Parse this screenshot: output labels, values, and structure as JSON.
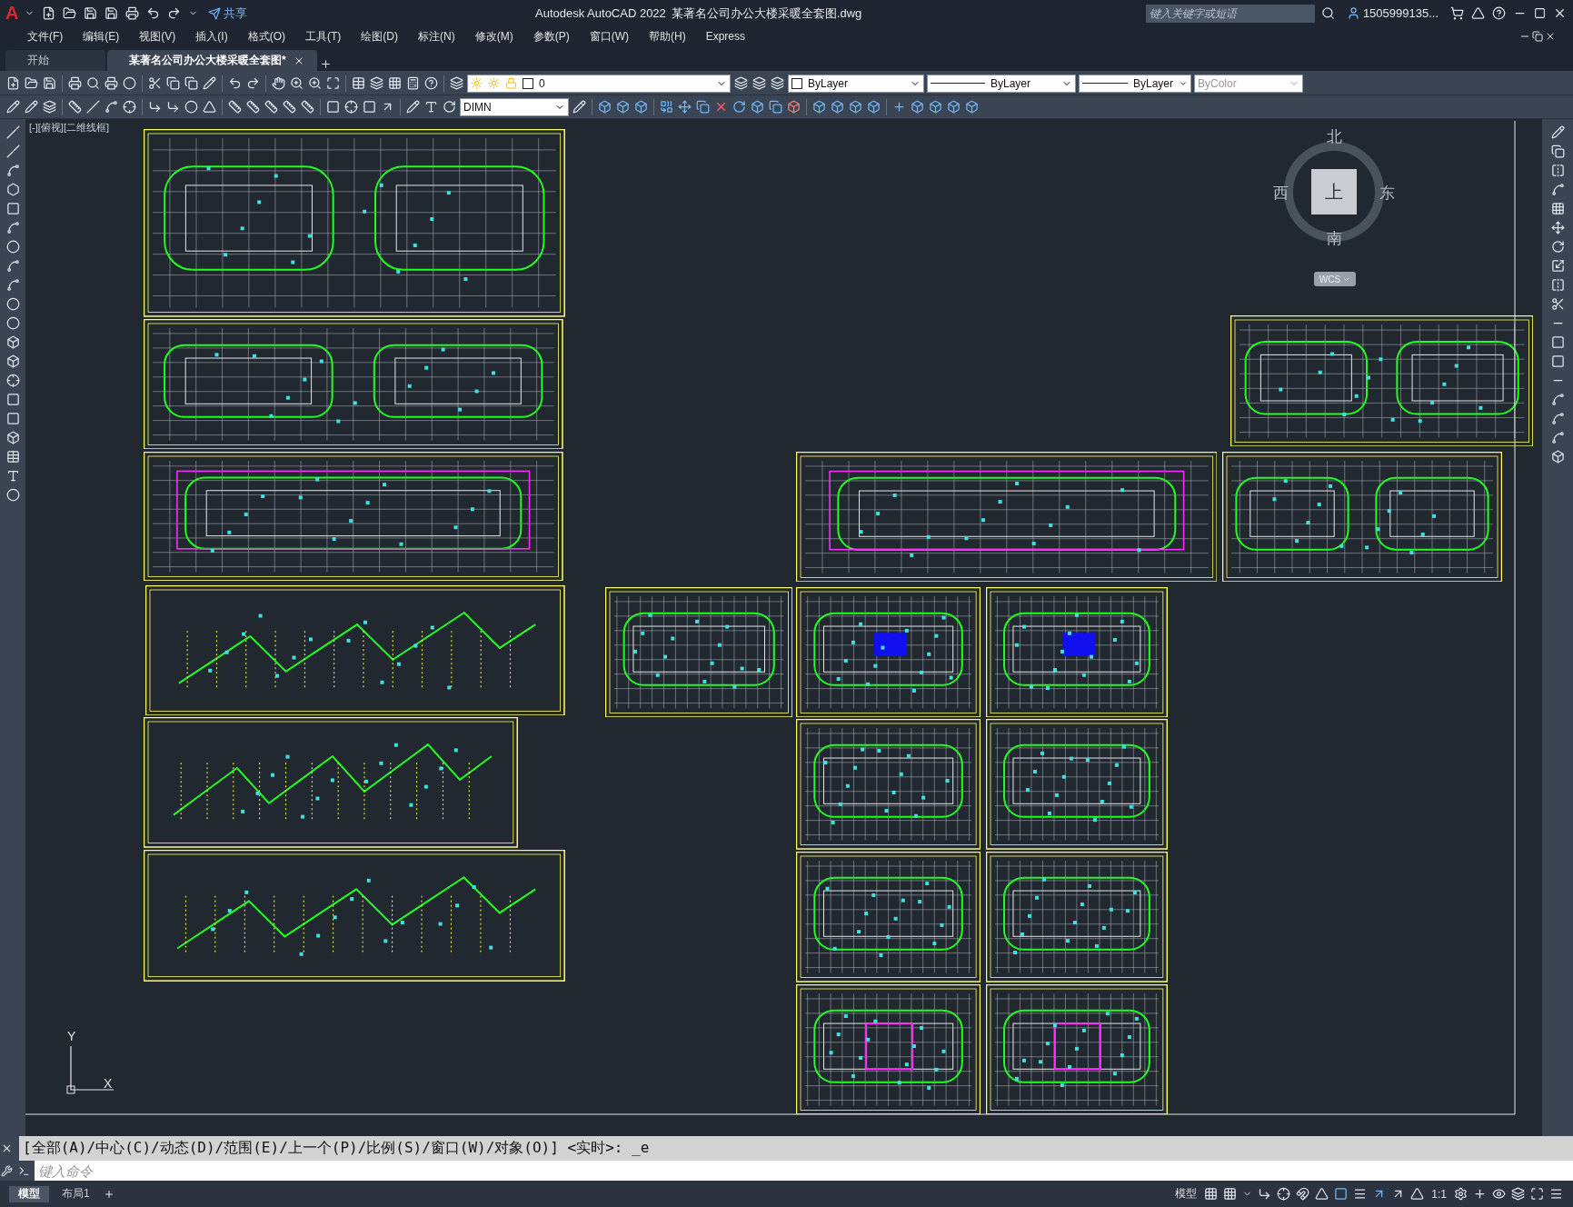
{
  "title_bar": {
    "logo": "A",
    "share": "共享",
    "app_title": "Autodesk AutoCAD 2022",
    "document": "某著名公司办公大楼采暖全套图.dwg",
    "search": {
      "placeholder": "键入关键字或短语"
    },
    "user": "1505999135..."
  },
  "menu": [
    "文件(F)",
    "编辑(E)",
    "视图(V)",
    "插入(I)",
    "格式(O)",
    "工具(T)",
    "绘图(D)",
    "标注(N)",
    "修改(M)",
    "参数(P)",
    "窗口(W)",
    "帮助(H)",
    "Express"
  ],
  "file_tabs": [
    {
      "label": "开始",
      "selected": false
    },
    {
      "label": "某著名公司办公大楼采暖全套图*",
      "selected": true
    }
  ],
  "properties": {
    "layer": "0",
    "color_setting": "ByLayer",
    "linetype": "ByLayer",
    "lineweight": "ByLayer",
    "plot_style": {
      "value": "ByColor",
      "disabled": true
    },
    "dim_style": "DIMN"
  },
  "viewport": {
    "label": "[-][俯视][二维线框]"
  },
  "view_cube": {
    "north": "北",
    "south": "南",
    "west": "西",
    "east": "东",
    "face": "上",
    "ucs": "WCS"
  },
  "ucs_icon": {
    "y": "Y",
    "x": "X"
  },
  "command_line": {
    "history": "[全部(A)/中心(C)/动态(D)/范围(E)/上一个(P)/比例(S)/窗口(W)/对象(O)] <实时>: _e",
    "placeholder": "键入命令"
  },
  "layout_tabs": [
    {
      "label": "模型",
      "selected": true
    },
    {
      "label": "布局1",
      "selected": false
    }
  ],
  "status_bar": {
    "space": "模型",
    "scale": "1:1"
  }
}
